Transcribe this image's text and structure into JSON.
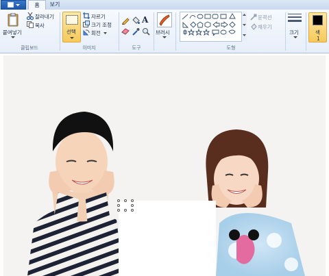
{
  "tabs": [
    {
      "label": "홈",
      "active": true
    },
    {
      "label": "보기",
      "active": false
    }
  ],
  "app_menu": {
    "icon": "paint-app-menu-icon"
  },
  "clipboard": {
    "paste_label": "붙여넣기",
    "cut_label": "잘라내기",
    "copy_label": "복사",
    "group_label": "클립보드"
  },
  "image": {
    "select_label": "선택",
    "crop_label": "자르기",
    "resize_label": "크기 조정",
    "rotate_label": "회전",
    "group_label": "이미지"
  },
  "tools": {
    "group_label": "도구",
    "items": [
      "pencil-icon",
      "fill-bucket-icon",
      "text-icon",
      "eraser-icon",
      "color-picker-icon",
      "magnifier-icon"
    ],
    "text_glyph": "A"
  },
  "brushes": {
    "label": "브러시"
  },
  "shapes": {
    "group_label": "도형",
    "outline_label": "윤곽선",
    "fill_label": "채우기"
  },
  "size": {
    "label": "크기"
  },
  "colors": {
    "color1_label": "색",
    "color1_sub": "1",
    "color1_value": "#000000"
  },
  "canvas": {
    "has_photo": true,
    "selection_active": true
  }
}
